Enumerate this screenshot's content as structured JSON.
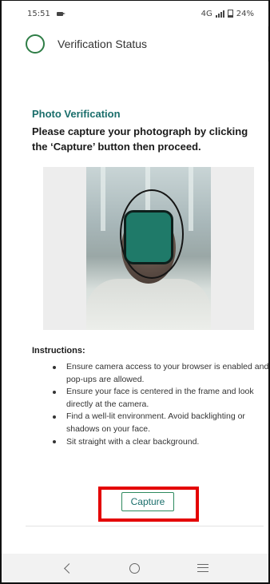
{
  "status_bar": {
    "time": "15:51",
    "network": "4G",
    "battery": "24%"
  },
  "header": {
    "title": "Verification Status"
  },
  "photo_verification": {
    "section_title": "Photo Verification",
    "prompt": "Please capture your photograph by clicking the ‘Capture’ button then proceed."
  },
  "instructions": {
    "label": "Instructions:",
    "items": [
      "Ensure camera access to your browser is enabled and pop-ups are allowed.",
      "Ensure your face is centered in the frame and look directly at the camera.",
      "Find a well-lit environment. Avoid backlighting or shadows on your face.",
      "Sit straight with a clear background."
    ]
  },
  "capture": {
    "label": "Capture"
  },
  "colors": {
    "accent": "#1a6e6b",
    "ring": "#2e7d46",
    "face_mask": "#1f7a69",
    "highlight": "#e40000"
  }
}
